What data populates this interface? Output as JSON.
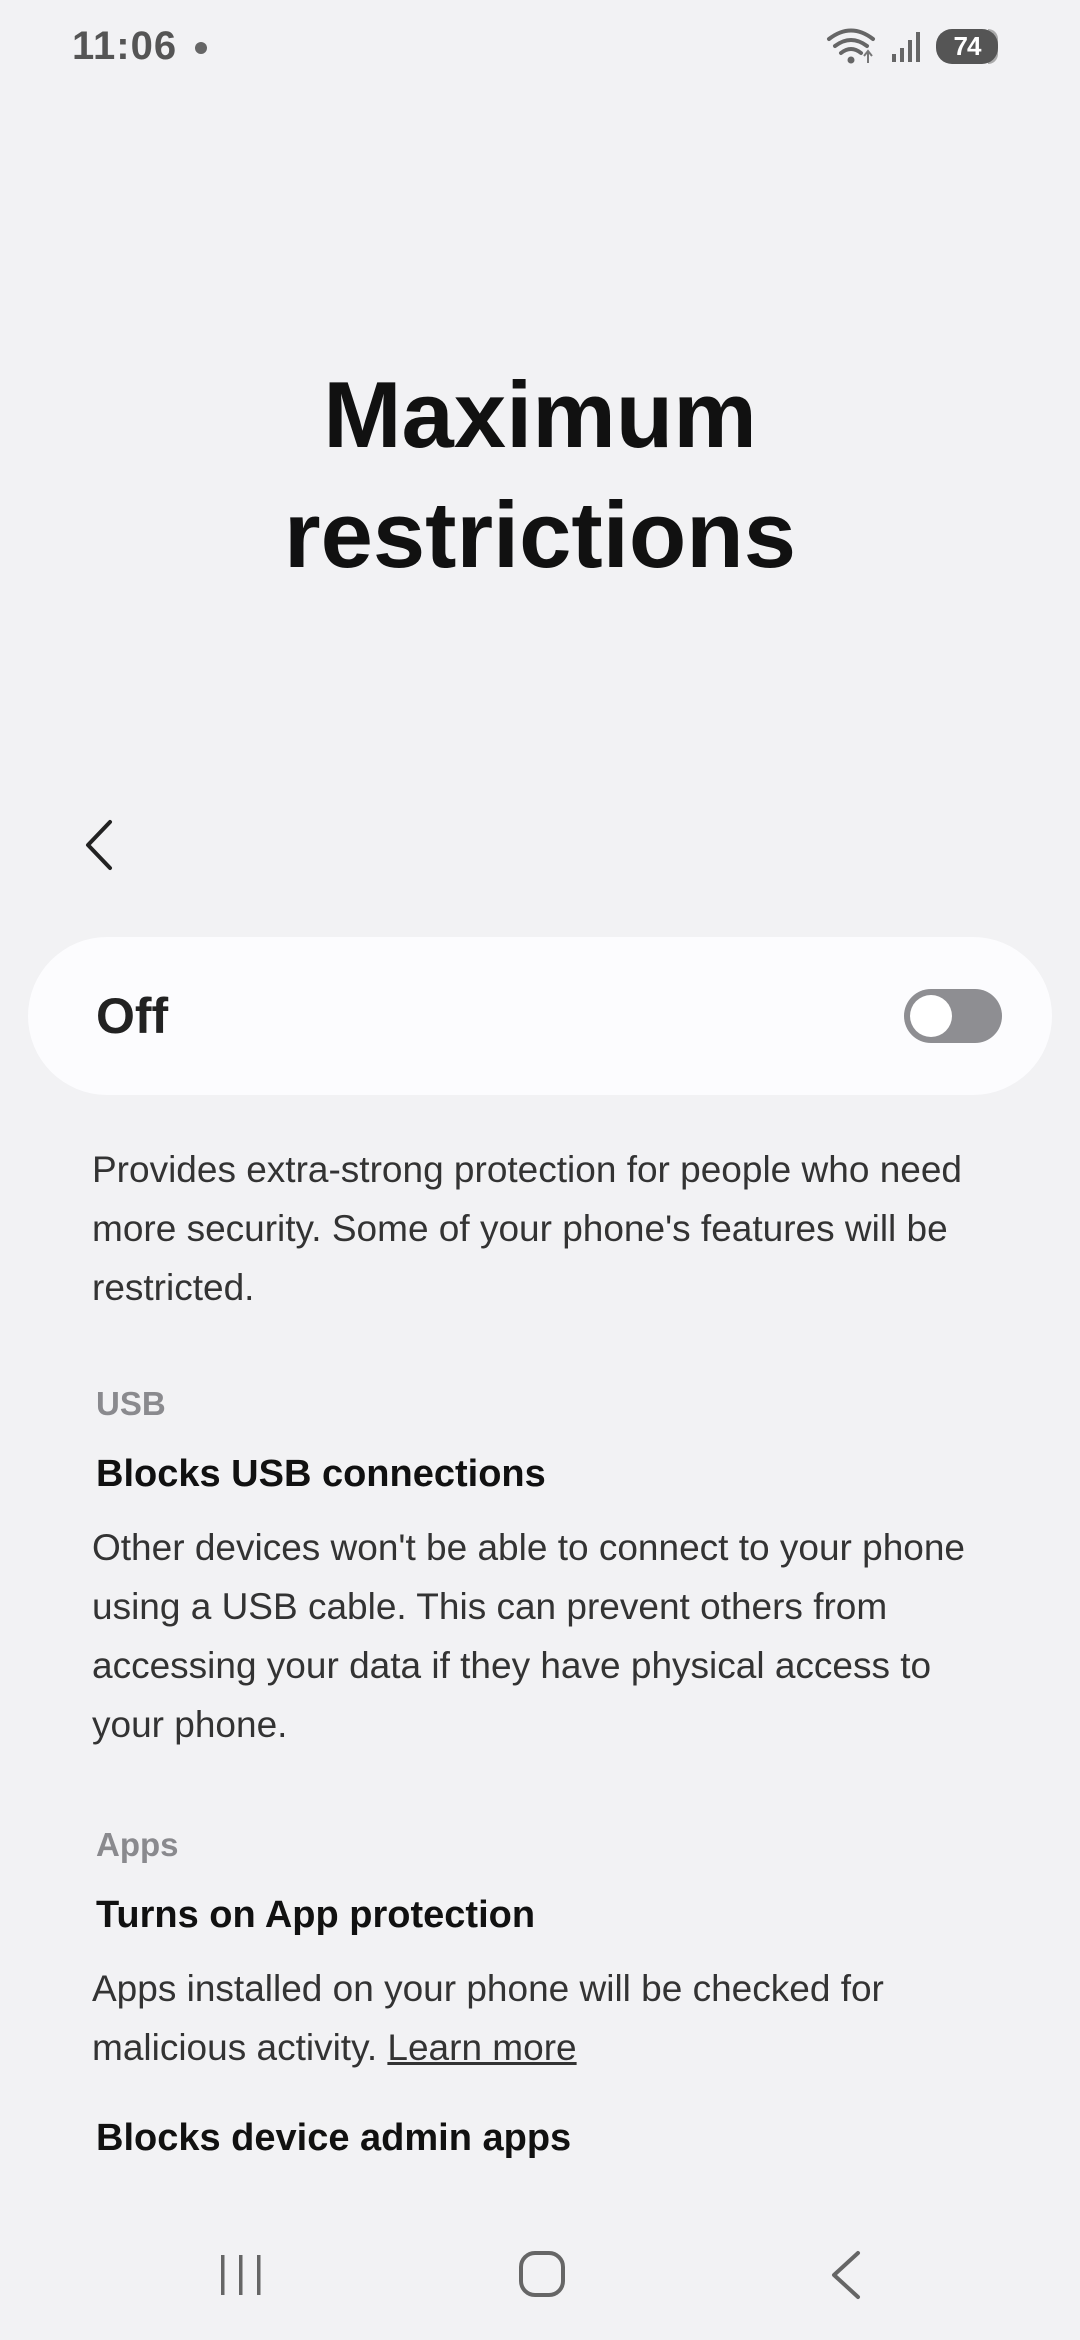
{
  "status_bar": {
    "time": "11:06",
    "battery": "74"
  },
  "page": {
    "title_line1": "Maximum",
    "title_line2": "restrictions"
  },
  "toggle": {
    "label": "Off",
    "state": "off"
  },
  "intro": "Provides extra-strong protection for people who need more security. Some of your phone's features will be restricted.",
  "sections": [
    {
      "header": "USB",
      "items": [
        {
          "title": "Blocks USB connections",
          "description": "Other devices won't be able to connect to your phone using a USB cable. This can prevent others from accessing your data if they have physical access to your phone."
        }
      ]
    },
    {
      "header": "Apps",
      "items": [
        {
          "title": "Turns on App protection",
          "description": "Apps installed on your phone will be checked for malicious activity.",
          "link": "Learn more"
        },
        {
          "title": "Blocks device admin apps"
        }
      ]
    }
  ],
  "icons": {
    "back": "chevron-left-icon",
    "wifi": "wifi-icon",
    "signal": "signal-icon",
    "nav_recents": "recents-icon",
    "nav_home": "home-icon",
    "nav_back": "back-icon"
  },
  "colors": {
    "background": "#f2f2f4",
    "card": "#fcfcfe",
    "toggle_off": "#8e8e92",
    "section_header": "#8a8a8e"
  }
}
